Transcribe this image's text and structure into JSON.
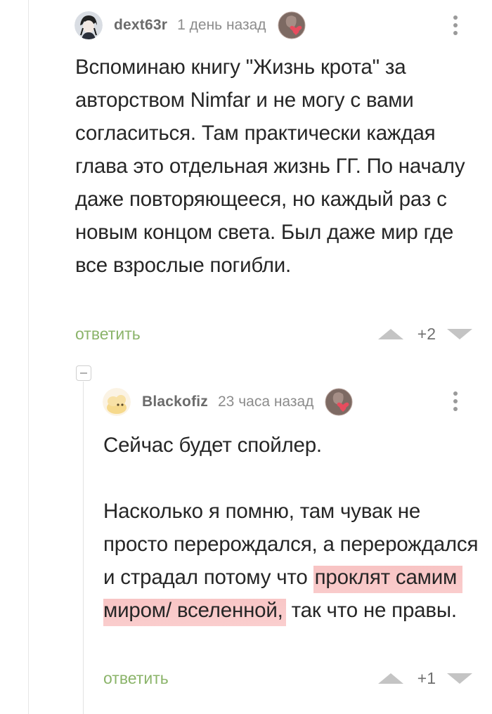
{
  "comments": [
    {
      "author": "dext63r",
      "time": "1 день назад",
      "text": "Вспоминаю книгу \"Жизнь крота\" за авторством Nimfar и не могу с вами согласиться. Там практически каждая глава это отдельная жизнь ГГ. По началу даже повторяющееся, но каждый раз с новым концом света. Был даже мир где все взрослые погибли.",
      "reply_label": "ответить",
      "score": "+2"
    },
    {
      "author": "Blackofiz",
      "time": "23 часа назад",
      "text_part1": "Сейчас будет спойлер.\n\nНасколько я помню, там чувак не просто перерождался, а перерождался и страдал потому что ",
      "text_highlight": "проклят самим миром/ вселенной,",
      "text_part2": " так что не правы.",
      "reply_label": "ответить",
      "score": "+1"
    }
  ],
  "icons": {
    "upvote": "triangle-up-icon",
    "downvote": "triangle-down-icon",
    "more": "vertical-dots-icon",
    "collapse": "minus-box-icon"
  },
  "colors": {
    "reply": "#8bb46a",
    "highlight": "#f6afaf",
    "vote_arrow": "#c4c4c4"
  }
}
